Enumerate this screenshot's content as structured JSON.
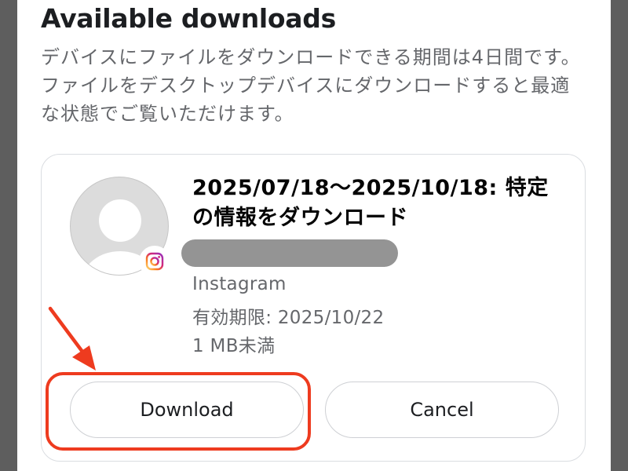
{
  "dialog": {
    "title": "Available downloads",
    "description": "デバイスにファイルをダウンロードできる期間は4日間です。ファイルをデスクトップデバイスにダウンロードすると最適な状態でご覧いただけます。"
  },
  "download_item": {
    "title": "2025/07/18～2025/10/18: 特定の情報をダウンロード",
    "source": "Instagram",
    "expiry": "有効期限: 2025/10/22",
    "size": "1 MB未満",
    "badge_icon": "instagram-icon",
    "avatar_icon": "default-profile-icon"
  },
  "actions": {
    "download_label": "Download",
    "cancel_label": "Cancel"
  },
  "annotation": {
    "color": "#ee3b1f",
    "target": "Download"
  },
  "colors": {
    "accent": "#ee3b1f",
    "text_primary": "#1c1e21",
    "text_secondary": "#65676b",
    "border": "#ced0d4"
  }
}
